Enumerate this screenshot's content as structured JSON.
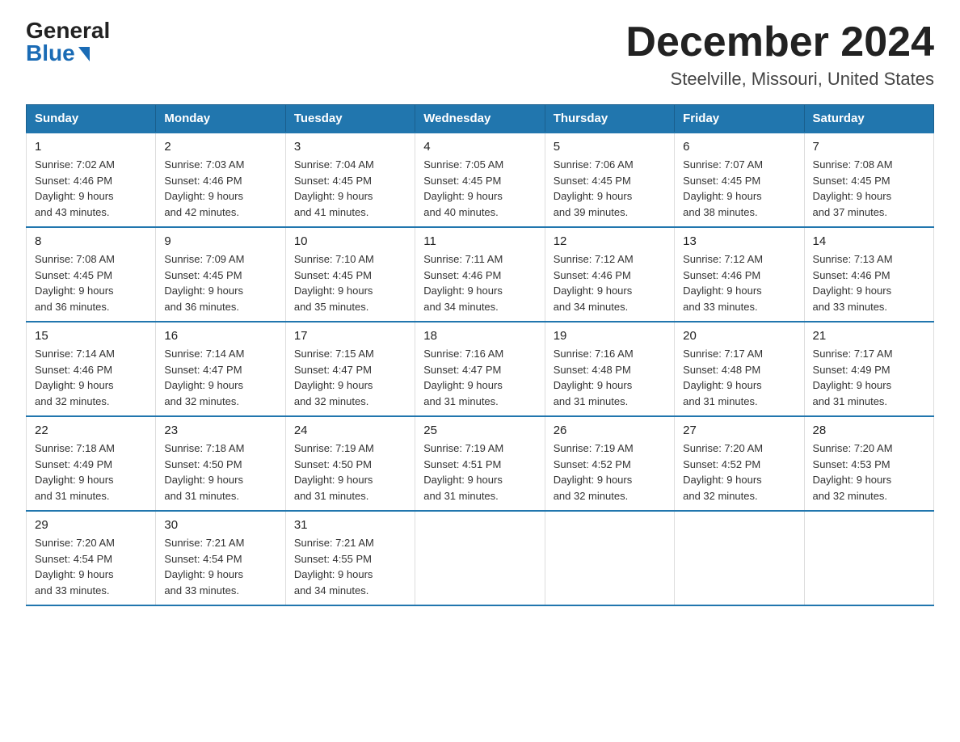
{
  "logo": {
    "general": "General",
    "blue": "Blue"
  },
  "title": {
    "month": "December 2024",
    "location": "Steelville, Missouri, United States"
  },
  "weekdays": [
    "Sunday",
    "Monday",
    "Tuesday",
    "Wednesday",
    "Thursday",
    "Friday",
    "Saturday"
  ],
  "weeks": [
    [
      {
        "day": "1",
        "sunrise": "7:02 AM",
        "sunset": "4:46 PM",
        "daylight": "9 hours and 43 minutes."
      },
      {
        "day": "2",
        "sunrise": "7:03 AM",
        "sunset": "4:46 PM",
        "daylight": "9 hours and 42 minutes."
      },
      {
        "day": "3",
        "sunrise": "7:04 AM",
        "sunset": "4:45 PM",
        "daylight": "9 hours and 41 minutes."
      },
      {
        "day": "4",
        "sunrise": "7:05 AM",
        "sunset": "4:45 PM",
        "daylight": "9 hours and 40 minutes."
      },
      {
        "day": "5",
        "sunrise": "7:06 AM",
        "sunset": "4:45 PM",
        "daylight": "9 hours and 39 minutes."
      },
      {
        "day": "6",
        "sunrise": "7:07 AM",
        "sunset": "4:45 PM",
        "daylight": "9 hours and 38 minutes."
      },
      {
        "day": "7",
        "sunrise": "7:08 AM",
        "sunset": "4:45 PM",
        "daylight": "9 hours and 37 minutes."
      }
    ],
    [
      {
        "day": "8",
        "sunrise": "7:08 AM",
        "sunset": "4:45 PM",
        "daylight": "9 hours and 36 minutes."
      },
      {
        "day": "9",
        "sunrise": "7:09 AM",
        "sunset": "4:45 PM",
        "daylight": "9 hours and 36 minutes."
      },
      {
        "day": "10",
        "sunrise": "7:10 AM",
        "sunset": "4:45 PM",
        "daylight": "9 hours and 35 minutes."
      },
      {
        "day": "11",
        "sunrise": "7:11 AM",
        "sunset": "4:46 PM",
        "daylight": "9 hours and 34 minutes."
      },
      {
        "day": "12",
        "sunrise": "7:12 AM",
        "sunset": "4:46 PM",
        "daylight": "9 hours and 34 minutes."
      },
      {
        "day": "13",
        "sunrise": "7:12 AM",
        "sunset": "4:46 PM",
        "daylight": "9 hours and 33 minutes."
      },
      {
        "day": "14",
        "sunrise": "7:13 AM",
        "sunset": "4:46 PM",
        "daylight": "9 hours and 33 minutes."
      }
    ],
    [
      {
        "day": "15",
        "sunrise": "7:14 AM",
        "sunset": "4:46 PM",
        "daylight": "9 hours and 32 minutes."
      },
      {
        "day": "16",
        "sunrise": "7:14 AM",
        "sunset": "4:47 PM",
        "daylight": "9 hours and 32 minutes."
      },
      {
        "day": "17",
        "sunrise": "7:15 AM",
        "sunset": "4:47 PM",
        "daylight": "9 hours and 32 minutes."
      },
      {
        "day": "18",
        "sunrise": "7:16 AM",
        "sunset": "4:47 PM",
        "daylight": "9 hours and 31 minutes."
      },
      {
        "day": "19",
        "sunrise": "7:16 AM",
        "sunset": "4:48 PM",
        "daylight": "9 hours and 31 minutes."
      },
      {
        "day": "20",
        "sunrise": "7:17 AM",
        "sunset": "4:48 PM",
        "daylight": "9 hours and 31 minutes."
      },
      {
        "day": "21",
        "sunrise": "7:17 AM",
        "sunset": "4:49 PM",
        "daylight": "9 hours and 31 minutes."
      }
    ],
    [
      {
        "day": "22",
        "sunrise": "7:18 AM",
        "sunset": "4:49 PM",
        "daylight": "9 hours and 31 minutes."
      },
      {
        "day": "23",
        "sunrise": "7:18 AM",
        "sunset": "4:50 PM",
        "daylight": "9 hours and 31 minutes."
      },
      {
        "day": "24",
        "sunrise": "7:19 AM",
        "sunset": "4:50 PM",
        "daylight": "9 hours and 31 minutes."
      },
      {
        "day": "25",
        "sunrise": "7:19 AM",
        "sunset": "4:51 PM",
        "daylight": "9 hours and 31 minutes."
      },
      {
        "day": "26",
        "sunrise": "7:19 AM",
        "sunset": "4:52 PM",
        "daylight": "9 hours and 32 minutes."
      },
      {
        "day": "27",
        "sunrise": "7:20 AM",
        "sunset": "4:52 PM",
        "daylight": "9 hours and 32 minutes."
      },
      {
        "day": "28",
        "sunrise": "7:20 AM",
        "sunset": "4:53 PM",
        "daylight": "9 hours and 32 minutes."
      }
    ],
    [
      {
        "day": "29",
        "sunrise": "7:20 AM",
        "sunset": "4:54 PM",
        "daylight": "9 hours and 33 minutes."
      },
      {
        "day": "30",
        "sunrise": "7:21 AM",
        "sunset": "4:54 PM",
        "daylight": "9 hours and 33 minutes."
      },
      {
        "day": "31",
        "sunrise": "7:21 AM",
        "sunset": "4:55 PM",
        "daylight": "9 hours and 34 minutes."
      },
      null,
      null,
      null,
      null
    ]
  ],
  "labels": {
    "sunrise": "Sunrise:",
    "sunset": "Sunset:",
    "daylight": "Daylight:"
  }
}
